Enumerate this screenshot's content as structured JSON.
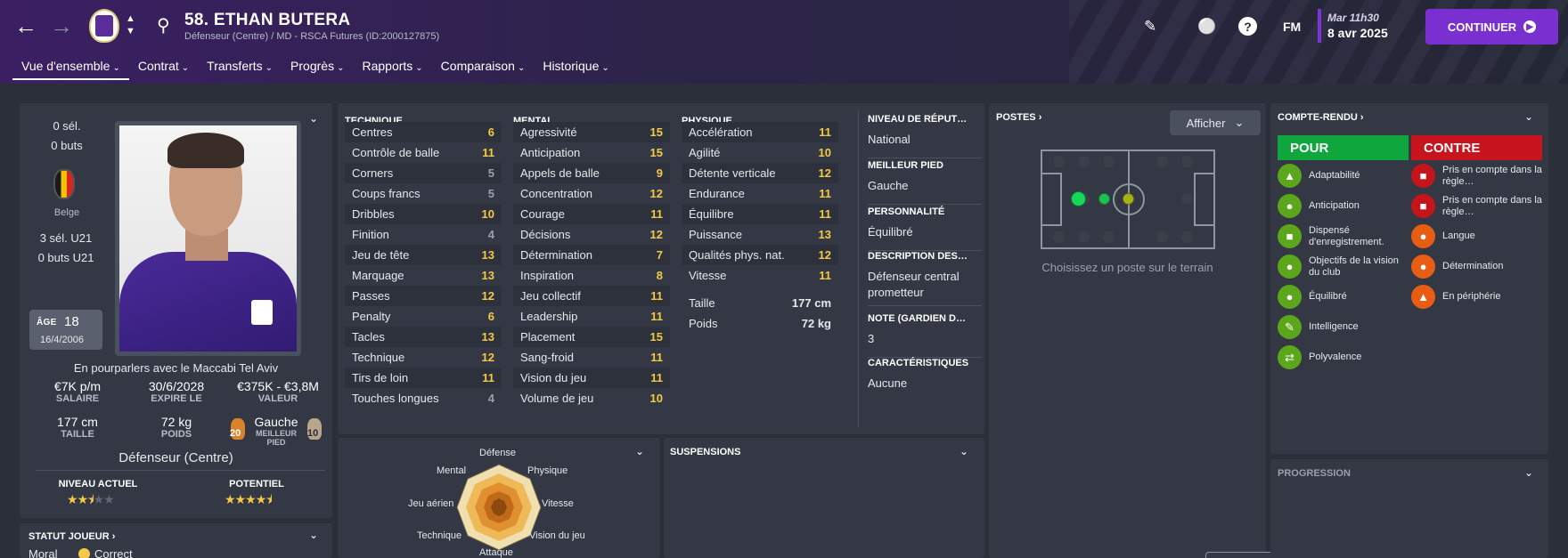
{
  "header": {
    "player_title": "58. ETHAN BUTERA",
    "player_subtitle": "Défenseur (Centre) / MD - RSCA Futures (ID:2000127875)",
    "time": "Mar 11h30",
    "date": "8 avr 2025",
    "fm_label": "FM",
    "help_label": "?",
    "continue_label": "CONTINUER"
  },
  "tabs": [
    {
      "label": "Vue d'ensemble"
    },
    {
      "label": "Contrat"
    },
    {
      "label": "Transferts"
    },
    {
      "label": "Progrès"
    },
    {
      "label": "Rapports"
    },
    {
      "label": "Comparaison"
    },
    {
      "label": "Historique"
    }
  ],
  "profile": {
    "selections": "0 sél.",
    "goals": "0 buts",
    "nationality": "Belge",
    "u21_selections": "3 sél. U21",
    "u21_goals": "0 buts U21",
    "age_label": "ÂGE",
    "age": "18",
    "birthdate": "16/4/2006",
    "transfer_status": "En pourparlers avec le Maccabi Tel Aviv",
    "wage": "€7K p/m",
    "wage_label": "SALAIRE",
    "expiry": "30/6/2028",
    "expiry_label": "EXPIRE LE",
    "value": "€375K - €3,8M",
    "value_label": "VALEUR",
    "height": "177 cm",
    "height_label": "TAILLE",
    "weight": "72 kg",
    "weight_label": "POIDS",
    "foot": "Gauche",
    "foot_label": "MEILLEUR PIED",
    "left_foot_rating": "20",
    "right_foot_rating": "10",
    "position": "Défenseur (Centre)",
    "current_ability_label": "NIVEAU ACTUEL",
    "current_ability_stars": 2.5,
    "potential_label": "POTENTIEL",
    "potential_stars": 4.5,
    "status_title": "STATUT JOUEUR",
    "morale_label": "Moral",
    "morale_value": "Correct"
  },
  "attributes": {
    "technical_title": "TECHNIQUE",
    "technical": [
      {
        "name": "Centres",
        "value": "6",
        "color": "#f6c945"
      },
      {
        "name": "Contrôle de balle",
        "value": "11",
        "color": "#f6c945"
      },
      {
        "name": "Corners",
        "value": "5",
        "color": "#9aa0ac"
      },
      {
        "name": "Coups francs",
        "value": "5",
        "color": "#9aa0ac"
      },
      {
        "name": "Dribbles",
        "value": "10",
        "color": "#f6c945"
      },
      {
        "name": "Finition",
        "value": "4",
        "color": "#9aa0ac"
      },
      {
        "name": "Jeu de tête",
        "value": "13",
        "color": "#f6c945"
      },
      {
        "name": "Marquage",
        "value": "13",
        "color": "#f6c945"
      },
      {
        "name": "Passes",
        "value": "12",
        "color": "#f6c945"
      },
      {
        "name": "Penalty",
        "value": "6",
        "color": "#f6c945"
      },
      {
        "name": "Tacles",
        "value": "13",
        "color": "#f6c945"
      },
      {
        "name": "Technique",
        "value": "12",
        "color": "#f6c945"
      },
      {
        "name": "Tirs de loin",
        "value": "11",
        "color": "#f6c945"
      },
      {
        "name": "Touches longues",
        "value": "4",
        "color": "#9aa0ac"
      }
    ],
    "mental_title": "MENTAL",
    "mental": [
      {
        "name": "Agressivité",
        "value": "15",
        "color": "#f6c945"
      },
      {
        "name": "Anticipation",
        "value": "15",
        "color": "#f6c945"
      },
      {
        "name": "Appels de balle",
        "value": "9",
        "color": "#f6c945"
      },
      {
        "name": "Concentration",
        "value": "12",
        "color": "#f6c945"
      },
      {
        "name": "Courage",
        "value": "11",
        "color": "#f6c945"
      },
      {
        "name": "Décisions",
        "value": "12",
        "color": "#f6c945"
      },
      {
        "name": "Détermination",
        "value": "7",
        "color": "#f6c945"
      },
      {
        "name": "Inspiration",
        "value": "8",
        "color": "#f6c945"
      },
      {
        "name": "Jeu collectif",
        "value": "11",
        "color": "#f6c945"
      },
      {
        "name": "Leadership",
        "value": "11",
        "color": "#f6c945"
      },
      {
        "name": "Placement",
        "value": "15",
        "color": "#f6c945"
      },
      {
        "name": "Sang-froid",
        "value": "11",
        "color": "#f6c945"
      },
      {
        "name": "Vision du jeu",
        "value": "11",
        "color": "#f6c945"
      },
      {
        "name": "Volume de jeu",
        "value": "10",
        "color": "#f6c945"
      }
    ],
    "physical_title": "PHYSIQUE",
    "physical": [
      {
        "name": "Accélération",
        "value": "11",
        "color": "#f6c945"
      },
      {
        "name": "Agilité",
        "value": "10",
        "color": "#f6c945"
      },
      {
        "name": "Détente verticale",
        "value": "12",
        "color": "#f6c945"
      },
      {
        "name": "Endurance",
        "value": "11",
        "color": "#f6c945"
      },
      {
        "name": "Équilibre",
        "value": "11",
        "color": "#f6c945"
      },
      {
        "name": "Puissance",
        "value": "13",
        "color": "#f6c945"
      },
      {
        "name": "Qualités phys. nat.",
        "value": "12",
        "color": "#f6c945"
      },
      {
        "name": "Vitesse",
        "value": "11",
        "color": "#f6c945"
      }
    ],
    "height_label": "Taille",
    "height_value": "177 cm",
    "weight_label": "Poids",
    "weight_value": "72 kg"
  },
  "info": {
    "reputation_label": "NIVEAU DE RÉPUT…",
    "reputation_value": "National",
    "foot_label": "MEILLEUR PIED",
    "foot_value": "Gauche",
    "personality_label": "PERSONNALITÉ",
    "personality_value": "Équilibré",
    "description_label": "DESCRIPTION DES…",
    "description_value": "Défenseur central prometteur",
    "note_label": "NOTE (GARDIEN D…",
    "note_value": "3",
    "traits_label": "CARACTÉRISTIQUES",
    "traits_value": "Aucune"
  },
  "positions": {
    "title": "POSTES",
    "show_button": "Afficher",
    "hint": "Choisissez un poste sur le terrain"
  },
  "radar": {
    "labels": [
      "Défense",
      "Physique",
      "Vitesse",
      "Vision du jeu",
      "Attaque",
      "Technique",
      "Jeu aérien",
      "Mental"
    ]
  },
  "suspensions": {
    "title": "SUSPENSIONS"
  },
  "report": {
    "title": "COMPTE-RENDU",
    "pros_label": "POUR",
    "cons_label": "CONTRE",
    "pros_color": "#0fa63d",
    "cons_color": "#c8141c",
    "pros": [
      {
        "label": "Adaptabilité",
        "icon": "suitcase-icon"
      },
      {
        "label": "Anticipation",
        "icon": "lightbulb-icon"
      },
      {
        "label": "Dispensé d'enregistrement.",
        "icon": "id-card-icon"
      },
      {
        "label": "Objectifs de la vision du club",
        "icon": "group-icon"
      },
      {
        "label": "Équilibré",
        "icon": "head-icon"
      },
      {
        "label": "Intelligence",
        "icon": "pencil-icon"
      },
      {
        "label": "Polyvalence",
        "icon": "arrows-icon"
      }
    ],
    "cons": [
      {
        "label": "Pris en compte dans la règle…",
        "icon": "clipboard-icon"
      },
      {
        "label": "Pris en compte dans la règle…",
        "icon": "clipboard-icon"
      },
      {
        "label": "Langue",
        "icon": "speech-icon"
      },
      {
        "label": "Détermination",
        "icon": "compass-icon"
      },
      {
        "label": "En périphérie",
        "icon": "flask-icon"
      }
    ]
  },
  "progression": {
    "title": "PROGRESSION"
  }
}
